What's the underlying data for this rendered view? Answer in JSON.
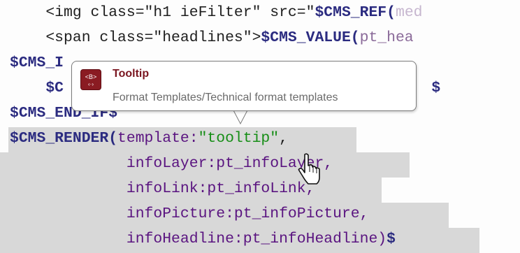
{
  "editor": {
    "lines": [
      [
        {
          "t": "    <img class=\"h1 ieFilter\" src=\"",
          "c": "plain"
        },
        {
          "t": "$CMS_REF(",
          "c": "kw"
        },
        {
          "t": "med",
          "c": "faded"
        }
      ],
      [
        {
          "t": "    <span class=\"headlines\">",
          "c": "plain"
        },
        {
          "t": "$CMS_VALUE(",
          "c": "kw"
        },
        {
          "t": "pt_hea",
          "c": "fade-dk"
        }
      ],
      [
        {
          "t": "$CMS_I",
          "c": "kw"
        }
      ],
      [
        {
          "t": "    $C",
          "c": "kw"
        },
        {
          "t": "                                         ",
          "c": "plain"
        },
        {
          "t": "$",
          "c": "kw"
        }
      ],
      [
        {
          "t": "$CMS_END_IF$",
          "c": "kw"
        }
      ],
      [
        {
          "t": "$CMS_RENDER(",
          "c": "kw"
        },
        {
          "t": "template:",
          "c": "fn"
        },
        {
          "t": "\"tooltip\"",
          "c": "grn"
        },
        {
          "t": ",",
          "c": "plain"
        }
      ],
      [
        {
          "t": "             infoLayer:pt_infoLayer,",
          "c": "fn"
        }
      ],
      [
        {
          "t": "             infoLink:pt_infoLink,",
          "c": "fn"
        }
      ],
      [
        {
          "t": "             infoPicture:pt_infoPicture,",
          "c": "fn"
        }
      ],
      [
        {
          "t": "             infoHeadline:pt_infoHeadline)",
          "c": "fn"
        },
        {
          "t": "$",
          "c": "kw"
        }
      ]
    ]
  },
  "tooltip": {
    "icon": "template-icon",
    "icon_glyph": "<B>",
    "title": "Tooltip",
    "subtitle": "Format Templates/Technical format templates"
  },
  "colors": {
    "keyword": "#2b2b80",
    "parameter": "#5a1480",
    "string_green": "#178e17",
    "selection": "#d8d8d8",
    "tooltip_title": "#7a1620",
    "tooltip_icon": "#8a1b22"
  }
}
